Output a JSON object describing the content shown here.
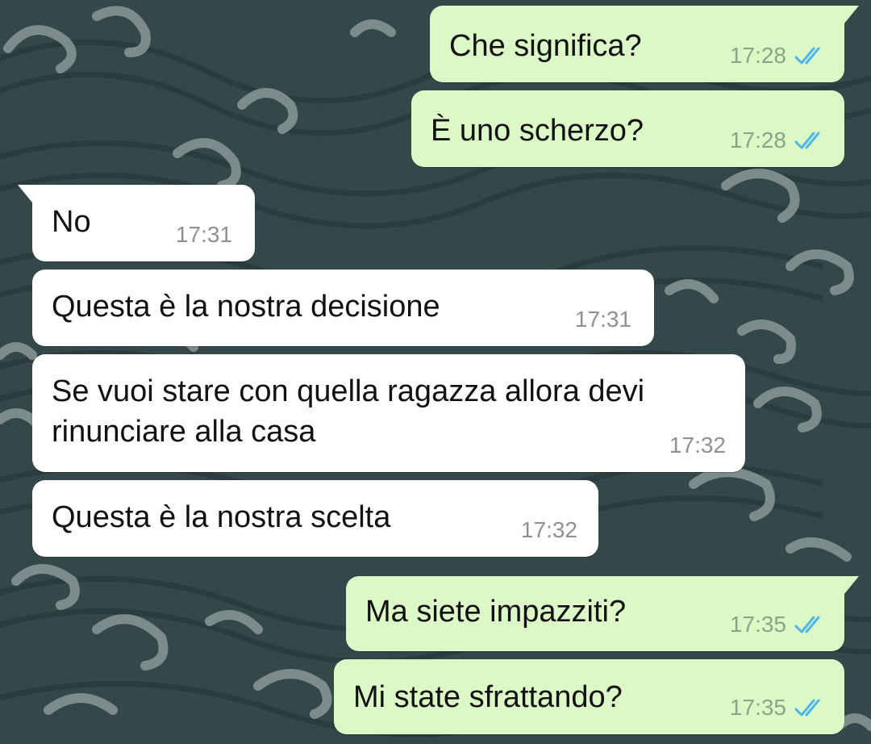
{
  "theme": {
    "incoming_bubble": "#ffffff",
    "outgoing_bubble": "#dcf8c6",
    "read_ticks": "#4fb6ec",
    "wallpaper_base": "#34484a",
    "wallpaper_wave": "#899996"
  },
  "messages": [
    {
      "direction": "out",
      "text": "Che significa?",
      "time": "17:28",
      "status": "read-ticks-icon"
    },
    {
      "direction": "out",
      "text": "È uno scherzo?",
      "time": "17:28",
      "status": "read-ticks-icon"
    },
    {
      "direction": "in",
      "text": "No",
      "time": "17:31"
    },
    {
      "direction": "in",
      "text": "Questa è la nostra decisione",
      "time": "17:31"
    },
    {
      "direction": "in",
      "text": "Se vuoi stare con quella ragazza allora devi\nrinunciare alla casa",
      "time": "17:32"
    },
    {
      "direction": "in",
      "text": "Questa è la nostra scelta",
      "time": "17:32"
    },
    {
      "direction": "out",
      "text": "Ma siete impazziti?",
      "time": "17:35",
      "status": "read-ticks-icon"
    },
    {
      "direction": "out",
      "text": "Mi state sfrattando?",
      "time": "17:35",
      "status": "read-ticks-icon"
    }
  ]
}
